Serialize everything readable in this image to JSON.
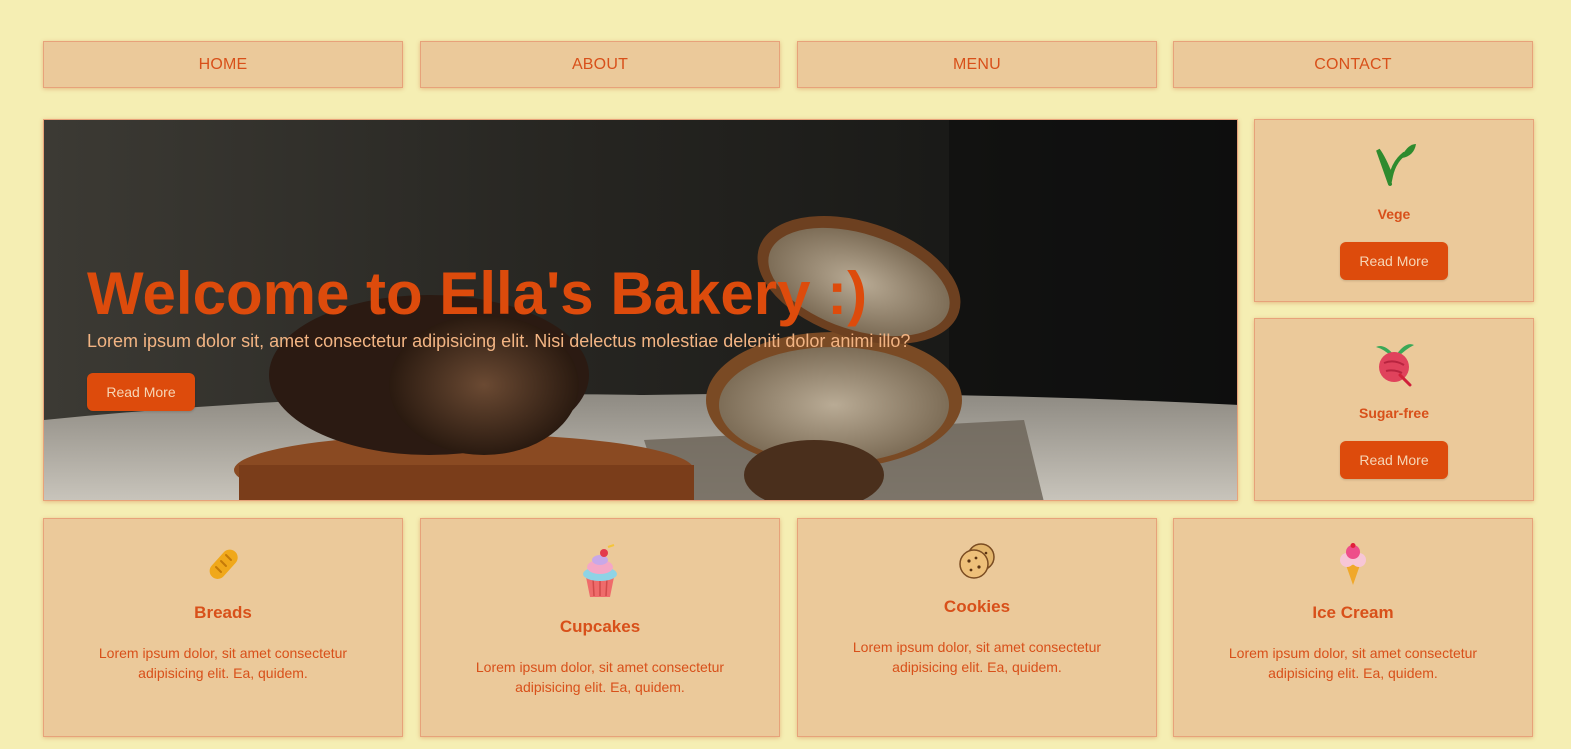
{
  "nav": {
    "items": [
      {
        "label": "HOME"
      },
      {
        "label": "ABOUT"
      },
      {
        "label": "MENU"
      },
      {
        "label": "CONTACT"
      }
    ]
  },
  "hero": {
    "title": "Welcome to Ella's Bakery :)",
    "subtitle": "Lorem ipsum dolor sit, amet consectetur adipisicing elit. Nisi delectus molestiae deleniti dolor animi illo?",
    "button_label": "Read More"
  },
  "side_cards": [
    {
      "title": "Vege",
      "icon": "sprout-icon",
      "button_label": "Read More"
    },
    {
      "title": "Sugar-free",
      "icon": "beet-icon",
      "button_label": "Read More"
    }
  ],
  "items": [
    {
      "title": "Breads",
      "icon": "bread-icon",
      "text": "Lorem ipsum dolor, sit amet consectetur adipisicing elit. Ea, quidem."
    },
    {
      "title": "Cupcakes",
      "icon": "cupcake-icon",
      "text": "Lorem ipsum dolor, sit amet consectetur adipisicing elit. Ea, quidem."
    },
    {
      "title": "Cookies",
      "icon": "cookie-icon",
      "text": "Lorem ipsum dolor, sit amet consectetur adipisicing elit. Ea, quidem."
    },
    {
      "title": "Ice Cream",
      "icon": "ice-cream-icon",
      "text": "Lorem ipsum dolor, sit amet consectetur adipisicing elit. Ea, quidem."
    }
  ],
  "colors": {
    "background": "#f5eeb3",
    "card": "#ebc99a",
    "accent": "#dd4b0c",
    "border": "#e7a27a"
  }
}
